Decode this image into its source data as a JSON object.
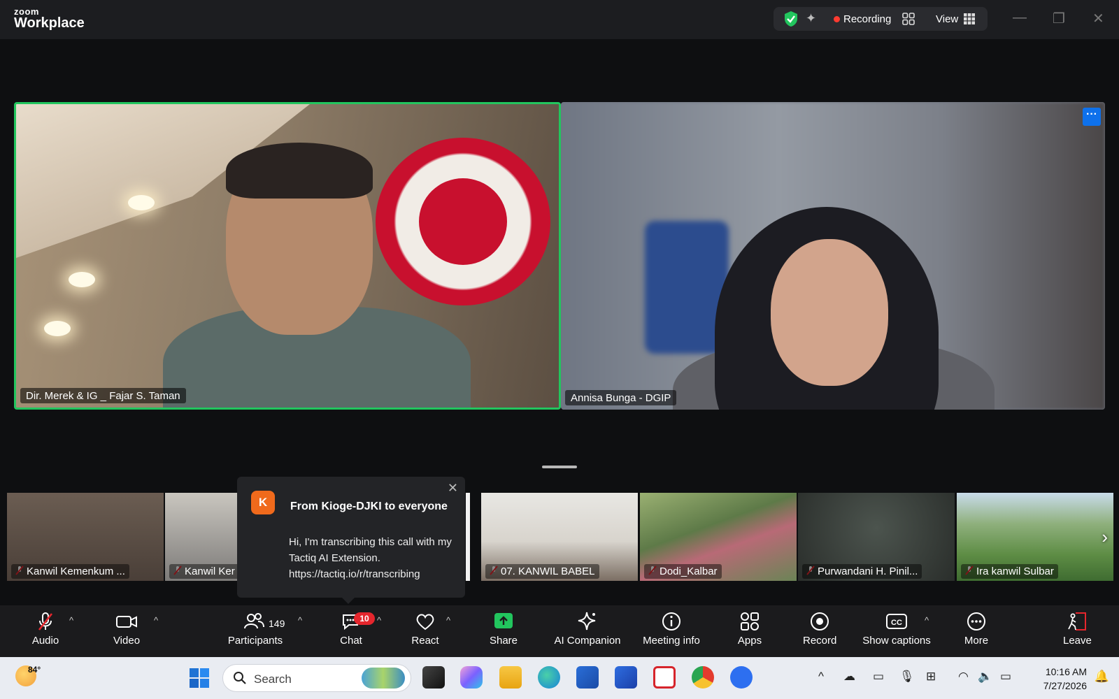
{
  "window": {
    "logo_small": "zoom",
    "logo_big": "Workplace",
    "recording_label": "Recording",
    "view_label": "View",
    "minimize": "—",
    "restore": "❐",
    "close": "✕"
  },
  "videos": {
    "speaker_name": "Dir. Merek & IG _ Fajar S. Taman",
    "second_name": "Annisa Bunga - DGIP",
    "more_label": "···"
  },
  "thumbnails": [
    {
      "name": "Kanwil Kemenkum ..."
    },
    {
      "name": "Kanwil Ker"
    },
    {
      "name": ""
    },
    {
      "name": "07. KANWIL BABEL"
    },
    {
      "name": "Dodi_Kalbar"
    },
    {
      "name": "Purwandani H. Pinil..."
    },
    {
      "name": "Ira kanwil Sulbar"
    }
  ],
  "chat_popup": {
    "avatar_letter": "K",
    "title": "From Kioge-DJKI to everyone",
    "message": "Hi, I'm transcribing this call with my Tactiq AI Extension. https://tactiq.io/r/transcribing",
    "close": "✕"
  },
  "toolbar": {
    "audio": "Audio",
    "video": "Video",
    "participants": "Participants",
    "participants_count": "149",
    "chat": "Chat",
    "chat_badge": "10",
    "react": "React",
    "share": "Share",
    "ai_companion": "AI Companion",
    "meeting_info": "Meeting info",
    "apps": "Apps",
    "record": "Record",
    "show_captions": "Show captions",
    "more": "More",
    "leave": "Leave",
    "caret": "^"
  },
  "taskbar": {
    "temperature": "84°",
    "search_placeholder": "Search",
    "time": "10:16 AM",
    "date": "7/27/2026",
    "tray_caret": "^"
  },
  "colors": {
    "active_speaker": "#22c55e",
    "recording": "#ff3b30",
    "share": "#22c55e",
    "badge": "#e5262d",
    "leave": "#e5262d",
    "avatar": "#f06a1c"
  }
}
